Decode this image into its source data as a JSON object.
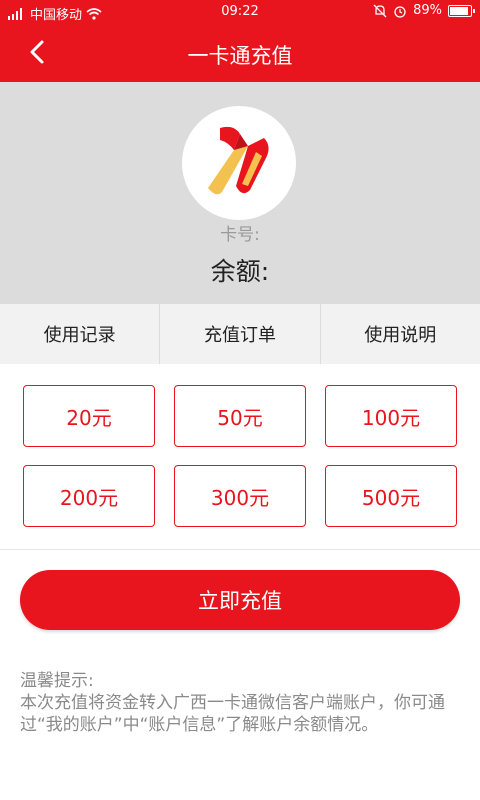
{
  "status_bar": {
    "carrier": "中国移动",
    "time": "09:22",
    "battery": "89%"
  },
  "nav": {
    "title": "一卡通充值"
  },
  "card": {
    "card_no_label": "卡号:",
    "balance_label": "余额:"
  },
  "tabs": [
    {
      "label": "使用记录"
    },
    {
      "label": "充值订单"
    },
    {
      "label": "使用说明"
    }
  ],
  "amounts": [
    {
      "label": "20元"
    },
    {
      "label": "50元"
    },
    {
      "label": "100元"
    },
    {
      "label": "200元"
    },
    {
      "label": "300元"
    },
    {
      "label": "500元"
    }
  ],
  "charge_button": {
    "label": "立即充值"
  },
  "tips": {
    "title": "温馨提示:",
    "body": "本次充值将资金转入广西一卡通微信客户端账户，你可通过“我的账户”中“账户信息”了解账户余额情况。"
  },
  "colors": {
    "accent": "#e8141e",
    "card_bg": "#dcdcdc",
    "tab_bg": "#f2f2f2"
  }
}
